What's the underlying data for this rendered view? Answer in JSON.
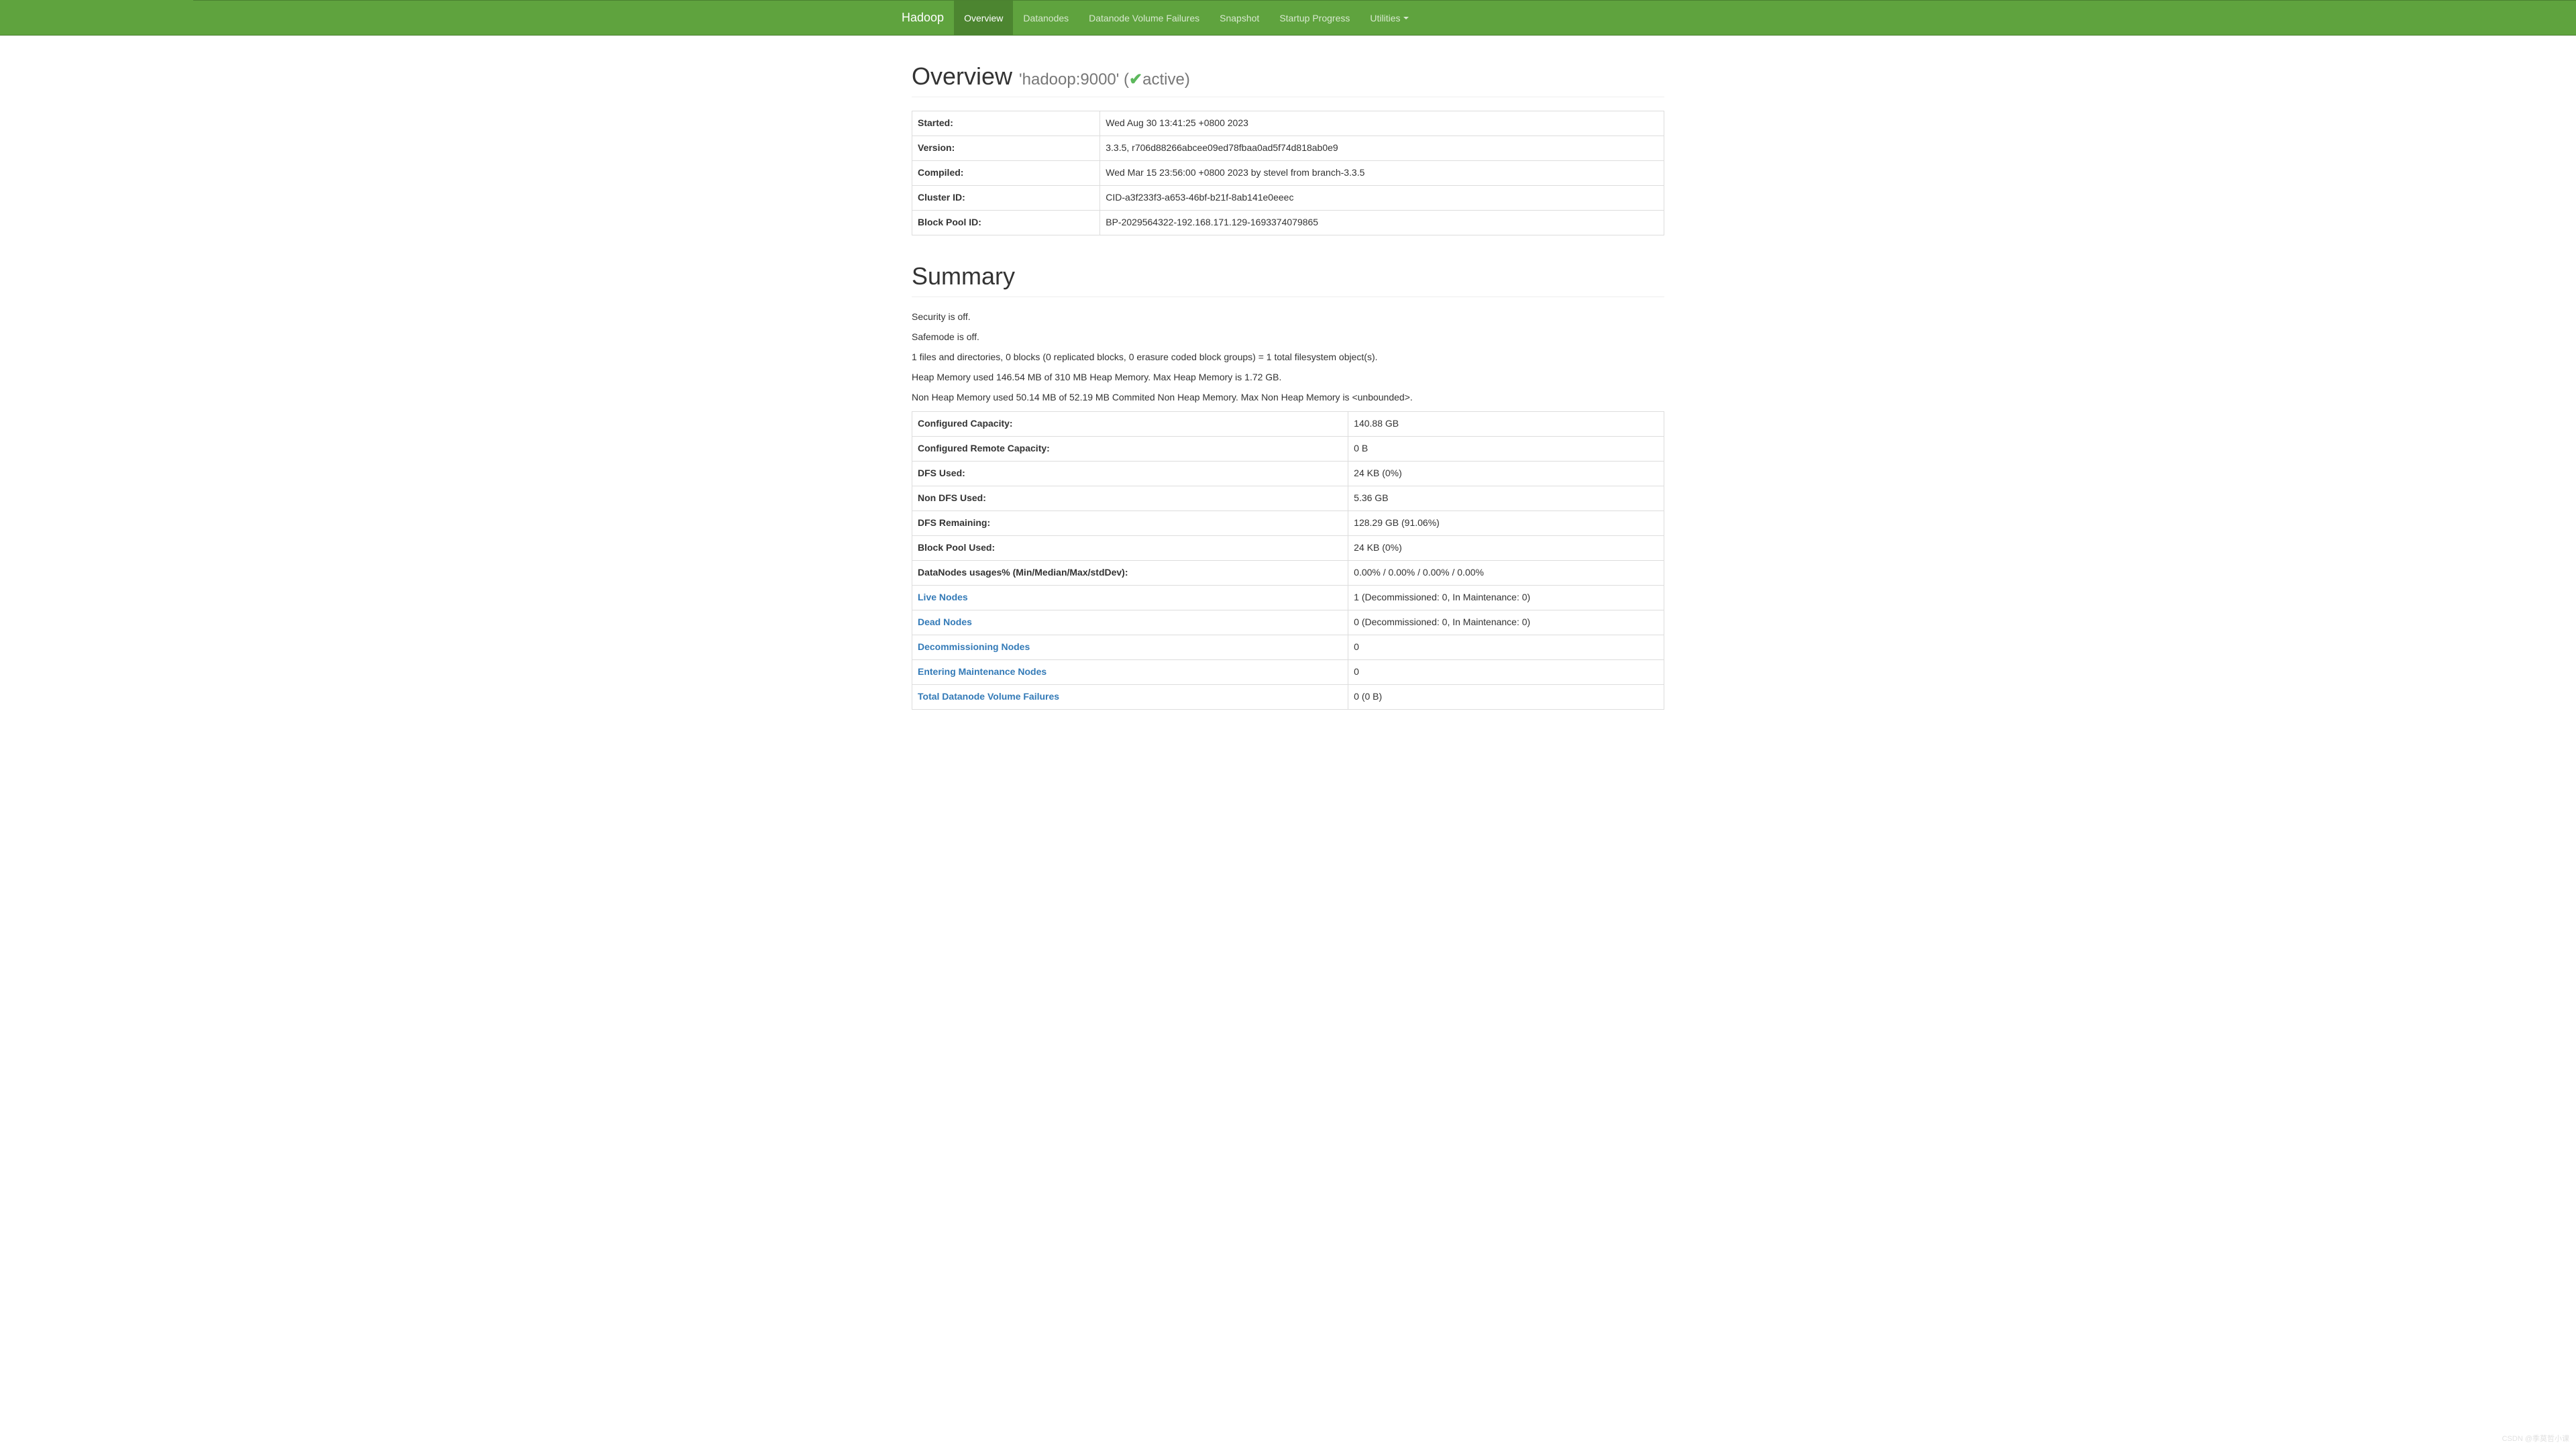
{
  "navbar": {
    "brand": "Hadoop",
    "tabs": [
      {
        "label": "Overview",
        "active": true
      },
      {
        "label": "Datanodes",
        "active": false
      },
      {
        "label": "Datanode Volume Failures",
        "active": false
      },
      {
        "label": "Snapshot",
        "active": false
      },
      {
        "label": "Startup Progress",
        "active": false
      },
      {
        "label": "Utilities",
        "active": false,
        "dropdown": true
      }
    ]
  },
  "overview": {
    "title": "Overview",
    "subtitle_host": "'hadoop:9000' (",
    "subtitle_status": "active)",
    "info_rows": [
      {
        "label": "Started:",
        "value": "Wed Aug 30 13:41:25 +0800 2023"
      },
      {
        "label": "Version:",
        "value": "3.3.5, r706d88266abcee09ed78fbaa0ad5f74d818ab0e9"
      },
      {
        "label": "Compiled:",
        "value": "Wed Mar 15 23:56:00 +0800 2023 by stevel from branch-3.3.5"
      },
      {
        "label": "Cluster ID:",
        "value": "CID-a3f233f3-a653-46bf-b21f-8ab141e0eeec"
      },
      {
        "label": "Block Pool ID:",
        "value": "BP-2029564322-192.168.171.129-1693374079865"
      }
    ]
  },
  "summary": {
    "title": "Summary",
    "text_lines": [
      "Security is off.",
      "Safemode is off.",
      "1 files and directories, 0 blocks (0 replicated blocks, 0 erasure coded block groups) = 1 total filesystem object(s).",
      "Heap Memory used 146.54 MB of 310 MB Heap Memory. Max Heap Memory is 1.72 GB.",
      "Non Heap Memory used 50.14 MB of 52.19 MB Commited Non Heap Memory. Max Non Heap Memory is <unbounded>."
    ],
    "rows": [
      {
        "label": "Configured Capacity:",
        "value": "140.88 GB",
        "link": false
      },
      {
        "label": "Configured Remote Capacity:",
        "value": "0 B",
        "link": false
      },
      {
        "label": "DFS Used:",
        "value": "24 KB (0%)",
        "link": false
      },
      {
        "label": "Non DFS Used:",
        "value": "5.36 GB",
        "link": false
      },
      {
        "label": "DFS Remaining:",
        "value": "128.29 GB (91.06%)",
        "link": false
      },
      {
        "label": "Block Pool Used:",
        "value": "24 KB (0%)",
        "link": false
      },
      {
        "label": "DataNodes usages% (Min/Median/Max/stdDev):",
        "value": "0.00% / 0.00% / 0.00% / 0.00%",
        "link": false
      },
      {
        "label": "Live Nodes",
        "value": "1 (Decommissioned: 0, In Maintenance: 0)",
        "link": true
      },
      {
        "label": "Dead Nodes",
        "value": "0 (Decommissioned: 0, In Maintenance: 0)",
        "link": true
      },
      {
        "label": "Decommissioning Nodes",
        "value": "0",
        "link": true
      },
      {
        "label": "Entering Maintenance Nodes",
        "value": "0",
        "link": true
      },
      {
        "label": "Total Datanode Volume Failures",
        "value": "0 (0 B)",
        "link": true
      }
    ]
  },
  "watermark": "CSDN @季莫哲小课"
}
